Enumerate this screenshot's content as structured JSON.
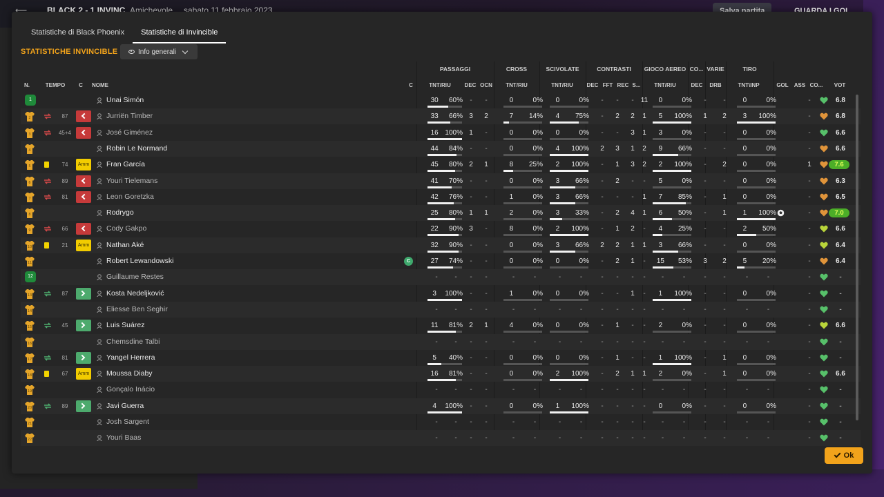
{
  "topbar": {
    "match": "BLACK  2 - 1  INVINC",
    "type": "Amichevole",
    "date": "sabato 11 febbraio 2023",
    "save_label": "Salva partita",
    "goals_label": "GUARDA I GOL"
  },
  "tabs": [
    "Statistiche di Black Phoenix",
    "Statistiche di Invincible"
  ],
  "active_tab": 1,
  "section_title": "STATISTICHE INVINCIBLE",
  "view_dropdown": "Info generali",
  "groups": {
    "passaggi": "PASSAGGI",
    "cross": "CROSS",
    "scivolate": "SCIVOLATE",
    "contrasti": "CONTRASTI",
    "gioco_aereo": "GIOCO AEREO",
    "co": "CO...",
    "varie": "VARIE",
    "tiro": "TIRO"
  },
  "headers": {
    "n": "N.",
    "tempo": "TEMPO",
    "c": "C",
    "nome": "NOME",
    "c2": "C",
    "pass_tnt": "TNT/RIU",
    "pass_dec": "DEC",
    "pass_ocn": "OCN",
    "cross_tnt": "TNT/RIU",
    "scivo_tnt": "TNT/RIU",
    "contr_dec": "DEC",
    "contr_fft": "FFT",
    "contr_rec": "REC",
    "contr_s": "S...",
    "aereo_tnt": "TNT/RIU",
    "co_dec": "DEC",
    "varie_drb": "DRB",
    "tiro_tnt": "TNT\\INP",
    "gol": "GOL",
    "ass": "ASS",
    "co": "CO...",
    "vot": "VOT"
  },
  "players": [
    {
      "n": "1",
      "gk": true,
      "tempo": "",
      "icon": "",
      "action": "",
      "name": "Unai Simón",
      "sub": false,
      "cap": false,
      "pass": [
        "30",
        "60%"
      ],
      "pbar": 0.6,
      "pdec": "-",
      "pocn": "-",
      "cross": [
        "0",
        "0%"
      ],
      "cbar": 0,
      "scivo": [
        "0",
        "0%"
      ],
      "sbar": 0,
      "cdec": "-",
      "cfft": "-",
      "crec": "-",
      "cs": "11",
      "aereo": [
        "0",
        "0%"
      ],
      "abar": 0,
      "codec": "-",
      "drb": "-",
      "tiro": [
        "0",
        "0%"
      ],
      "tbar": 0,
      "gol": "",
      "ass": "-",
      "heart": "#57c06a",
      "vot": "6.8",
      "vbadge": false
    },
    {
      "n": "2",
      "gk": false,
      "tempo": "87",
      "icon": "swap-red",
      "action": "out",
      "name": "Jurriën Timber",
      "sub": true,
      "cap": false,
      "pass": [
        "33",
        "66%"
      ],
      "pbar": 0.66,
      "pdec": "3",
      "pocn": "2",
      "cross": [
        "7",
        "14%"
      ],
      "cbar": 0.14,
      "scivo": [
        "4",
        "75%"
      ],
      "sbar": 0.75,
      "cdec": "-",
      "cfft": "2",
      "crec": "2",
      "cs": "1",
      "aereo": [
        "5",
        "100%"
      ],
      "abar": 1,
      "codec": "1",
      "drb": "2",
      "tiro": [
        "3",
        "100%"
      ],
      "tbar": 1,
      "gol": "",
      "ass": "-",
      "heart": "#e0943a",
      "vot": "6.8",
      "vbadge": false
    },
    {
      "n": "3",
      "gk": false,
      "tempo": "45+4",
      "icon": "swap-red",
      "action": "out",
      "name": "José Giménez",
      "sub": true,
      "cap": false,
      "pass": [
        "16",
        "100%"
      ],
      "pbar": 1,
      "pdec": "1",
      "pocn": "-",
      "cross": [
        "0",
        "0%"
      ],
      "cbar": 0,
      "scivo": [
        "0",
        "0%"
      ],
      "sbar": 0,
      "cdec": "-",
      "cfft": "-",
      "crec": "3",
      "cs": "1",
      "aereo": [
        "3",
        "0%"
      ],
      "abar": 0,
      "codec": "-",
      "drb": "-",
      "tiro": [
        "0",
        "0%"
      ],
      "tbar": 0,
      "gol": "",
      "ass": "-",
      "heart": "#57c06a",
      "vot": "6.6",
      "vbadge": false
    },
    {
      "n": "4",
      "gk": false,
      "tempo": "",
      "icon": "",
      "action": "",
      "name": "Robin Le Normand",
      "sub": false,
      "cap": false,
      "pass": [
        "44",
        "84%"
      ],
      "pbar": 0.84,
      "pdec": "-",
      "pocn": "-",
      "cross": [
        "0",
        "0%"
      ],
      "cbar": 0,
      "scivo": [
        "4",
        "100%"
      ],
      "sbar": 1,
      "cdec": "2",
      "cfft": "3",
      "crec": "1",
      "cs": "2",
      "aereo": [
        "9",
        "66%"
      ],
      "abar": 0.66,
      "codec": "-",
      "drb": "-",
      "tiro": [
        "0",
        "0%"
      ],
      "tbar": 0,
      "gol": "",
      "ass": "-",
      "heart": "#e0943a",
      "vot": "6.6",
      "vbadge": false
    },
    {
      "n": "5",
      "gk": false,
      "tempo": "74",
      "icon": "yellow",
      "action": "amm",
      "name": "Fran García",
      "sub": false,
      "cap": false,
      "pass": [
        "45",
        "80%"
      ],
      "pbar": 0.8,
      "pdec": "2",
      "pocn": "1",
      "cross": [
        "8",
        "25%"
      ],
      "cbar": 0.25,
      "scivo": [
        "2",
        "100%"
      ],
      "sbar": 1,
      "cdec": "-",
      "cfft": "1",
      "crec": "3",
      "cs": "2",
      "aereo": [
        "2",
        "100%"
      ],
      "abar": 1,
      "codec": "-",
      "drb": "2",
      "tiro": [
        "0",
        "0%"
      ],
      "tbar": 0,
      "gol": "",
      "ass": "1",
      "heart": "#e0943a",
      "vot": "7.6",
      "vbadge": true
    },
    {
      "n": "6",
      "gk": false,
      "tempo": "89",
      "icon": "swap-red",
      "action": "out",
      "name": "Youri Tielemans",
      "sub": true,
      "cap": false,
      "pass": [
        "41",
        "70%"
      ],
      "pbar": 0.7,
      "pdec": "-",
      "pocn": "-",
      "cross": [
        "0",
        "0%"
      ],
      "cbar": 0,
      "scivo": [
        "3",
        "66%"
      ],
      "sbar": 0.66,
      "cdec": "-",
      "cfft": "2",
      "crec": "-",
      "cs": "-",
      "aereo": [
        "5",
        "0%"
      ],
      "abar": 0,
      "codec": "-",
      "drb": "-",
      "tiro": [
        "0",
        "0%"
      ],
      "tbar": 0,
      "gol": "",
      "ass": "-",
      "heart": "#e0943a",
      "vot": "6.3",
      "vbadge": false
    },
    {
      "n": "7",
      "gk": false,
      "tempo": "81",
      "icon": "swap-red",
      "action": "out",
      "name": "Leon Goretzka",
      "sub": true,
      "cap": false,
      "pass": [
        "42",
        "76%"
      ],
      "pbar": 0.76,
      "pdec": "-",
      "pocn": "-",
      "cross": [
        "1",
        "0%"
      ],
      "cbar": 0,
      "scivo": [
        "3",
        "66%"
      ],
      "sbar": 0.66,
      "cdec": "-",
      "cfft": "-",
      "crec": "-",
      "cs": "1",
      "aereo": [
        "7",
        "85%"
      ],
      "abar": 0.85,
      "codec": "-",
      "drb": "1",
      "tiro": [
        "0",
        "0%"
      ],
      "tbar": 0,
      "gol": "",
      "ass": "-",
      "heart": "#e0943a",
      "vot": "6.5",
      "vbadge": false
    },
    {
      "n": "8",
      "gk": false,
      "tempo": "",
      "icon": "",
      "action": "",
      "name": "Rodrygo",
      "sub": false,
      "cap": false,
      "pass": [
        "25",
        "80%"
      ],
      "pbar": 0.8,
      "pdec": "1",
      "pocn": "1",
      "cross": [
        "2",
        "0%"
      ],
      "cbar": 0,
      "scivo": [
        "3",
        "33%"
      ],
      "sbar": 0.33,
      "cdec": "-",
      "cfft": "2",
      "crec": "4",
      "cs": "1",
      "aereo": [
        "6",
        "50%"
      ],
      "abar": 0.5,
      "codec": "-",
      "drb": "1",
      "tiro": [
        "1",
        "100%"
      ],
      "tbar": 1,
      "gol": "ball",
      "ass": "-",
      "heart": "#e0943a",
      "vot": "7.0",
      "vbadge": true
    },
    {
      "n": "9",
      "gk": false,
      "tempo": "66",
      "icon": "swap-red",
      "action": "out",
      "name": "Cody Gakpo",
      "sub": true,
      "cap": false,
      "pass": [
        "22",
        "90%"
      ],
      "pbar": 0.9,
      "pdec": "3",
      "pocn": "-",
      "cross": [
        "8",
        "0%"
      ],
      "cbar": 0,
      "scivo": [
        "2",
        "100%"
      ],
      "sbar": 1,
      "cdec": "-",
      "cfft": "1",
      "crec": "2",
      "cs": "-",
      "aereo": [
        "4",
        "25%"
      ],
      "abar": 0.25,
      "codec": "-",
      "drb": "-",
      "tiro": [
        "2",
        "50%"
      ],
      "tbar": 0.5,
      "gol": "",
      "ass": "-",
      "heart": "#b8d43a",
      "vot": "6.6",
      "vbadge": false
    },
    {
      "n": "10",
      "gk": false,
      "tempo": "21",
      "icon": "yellow",
      "action": "amm",
      "name": "Nathan Aké",
      "sub": false,
      "cap": false,
      "pass": [
        "32",
        "90%"
      ],
      "pbar": 0.9,
      "pdec": "-",
      "pocn": "-",
      "cross": [
        "0",
        "0%"
      ],
      "cbar": 0,
      "scivo": [
        "3",
        "66%"
      ],
      "sbar": 0.66,
      "cdec": "2",
      "cfft": "2",
      "crec": "1",
      "cs": "1",
      "aereo": [
        "3",
        "66%"
      ],
      "abar": 0.66,
      "codec": "-",
      "drb": "-",
      "tiro": [
        "0",
        "0%"
      ],
      "tbar": 0,
      "gol": "",
      "ass": "-",
      "heart": "#b8d43a",
      "vot": "6.4",
      "vbadge": false
    },
    {
      "n": "11",
      "gk": false,
      "tempo": "",
      "icon": "",
      "action": "",
      "name": "Robert Lewandowski",
      "sub": false,
      "cap": true,
      "pass": [
        "27",
        "74%"
      ],
      "pbar": 0.74,
      "pdec": "-",
      "pocn": "-",
      "cross": [
        "0",
        "0%"
      ],
      "cbar": 0,
      "scivo": [
        "0",
        "0%"
      ],
      "sbar": 0,
      "cdec": "-",
      "cfft": "2",
      "crec": "1",
      "cs": "-",
      "aereo": [
        "15",
        "53%"
      ],
      "abar": 0.53,
      "codec": "3",
      "drb": "2",
      "tiro": [
        "5",
        "20%"
      ],
      "tbar": 0.2,
      "gol": "",
      "ass": "-",
      "heart": "#e0943a",
      "vot": "6.4",
      "vbadge": false
    },
    {
      "n": "12",
      "gk": true,
      "tempo": "",
      "icon": "",
      "action": "",
      "name": "Guillaume Restes",
      "sub": true,
      "cap": false,
      "pass": [
        "-",
        "-"
      ],
      "pbar": -1,
      "pdec": "-",
      "pocn": "-",
      "cross": [
        "-",
        "-"
      ],
      "cbar": -1,
      "scivo": [
        "-",
        "-"
      ],
      "sbar": -1,
      "cdec": "-",
      "cfft": "-",
      "crec": "-",
      "cs": "-",
      "aereo": [
        "-",
        "-"
      ],
      "abar": -1,
      "codec": "-",
      "drb": "-",
      "tiro": [
        "-",
        "-"
      ],
      "tbar": -1,
      "gol": "",
      "ass": "-",
      "heart": "#57c06a",
      "vot": "-",
      "vbadge": false
    },
    {
      "n": "13",
      "gk": false,
      "tempo": "87",
      "icon": "swap-green",
      "action": "in",
      "name": "Kosta Nedeljković",
      "sub": false,
      "cap": false,
      "pass": [
        "3",
        "100%"
      ],
      "pbar": 1,
      "pdec": "-",
      "pocn": "-",
      "cross": [
        "1",
        "0%"
      ],
      "cbar": 0,
      "scivo": [
        "0",
        "0%"
      ],
      "sbar": 0,
      "cdec": "-",
      "cfft": "-",
      "crec": "1",
      "cs": "-",
      "aereo": [
        "1",
        "100%"
      ],
      "abar": 1,
      "codec": "-",
      "drb": "-",
      "tiro": [
        "0",
        "0%"
      ],
      "tbar": 0,
      "gol": "",
      "ass": "-",
      "heart": "#57c06a",
      "vot": "-",
      "vbadge": false
    },
    {
      "n": "14",
      "gk": false,
      "tempo": "",
      "icon": "",
      "action": "",
      "name": "Eliesse Ben Seghir",
      "sub": true,
      "cap": false,
      "pass": [
        "-",
        "-"
      ],
      "pbar": -1,
      "pdec": "-",
      "pocn": "-",
      "cross": [
        "-",
        "-"
      ],
      "cbar": -1,
      "scivo": [
        "-",
        "-"
      ],
      "sbar": -1,
      "cdec": "-",
      "cfft": "-",
      "crec": "-",
      "cs": "-",
      "aereo": [
        "-",
        "-"
      ],
      "abar": -1,
      "codec": "-",
      "drb": "-",
      "tiro": [
        "-",
        "-"
      ],
      "tbar": -1,
      "gol": "",
      "ass": "-",
      "heart": "#57c06a",
      "vot": "-",
      "vbadge": false
    },
    {
      "n": "15",
      "gk": false,
      "tempo": "45",
      "icon": "swap-green",
      "action": "in",
      "name": "Luis Suárez",
      "sub": false,
      "cap": false,
      "pass": [
        "11",
        "81%"
      ],
      "pbar": 0.81,
      "pdec": "2",
      "pocn": "1",
      "cross": [
        "4",
        "0%"
      ],
      "cbar": 0,
      "scivo": [
        "0",
        "0%"
      ],
      "sbar": 0,
      "cdec": "-",
      "cfft": "1",
      "crec": "-",
      "cs": "-",
      "aereo": [
        "2",
        "0%"
      ],
      "abar": 0,
      "codec": "-",
      "drb": "-",
      "tiro": [
        "0",
        "0%"
      ],
      "tbar": 0,
      "gol": "",
      "ass": "-",
      "heart": "#b8d43a",
      "vot": "6.6",
      "vbadge": false
    },
    {
      "n": "16",
      "gk": false,
      "tempo": "",
      "icon": "",
      "action": "",
      "name": "Chemsdine Talbi",
      "sub": true,
      "cap": false,
      "pass": [
        "-",
        "-"
      ],
      "pbar": -1,
      "pdec": "-",
      "pocn": "-",
      "cross": [
        "-",
        "-"
      ],
      "cbar": -1,
      "scivo": [
        "-",
        "-"
      ],
      "sbar": -1,
      "cdec": "-",
      "cfft": "-",
      "crec": "-",
      "cs": "-",
      "aereo": [
        "-",
        "-"
      ],
      "abar": -1,
      "codec": "-",
      "drb": "-",
      "tiro": [
        "-",
        "-"
      ],
      "tbar": -1,
      "gol": "",
      "ass": "-",
      "heart": "#57c06a",
      "vot": "-",
      "vbadge": false
    },
    {
      "n": "17",
      "gk": false,
      "tempo": "81",
      "icon": "swap-green",
      "action": "in",
      "name": "Yangel Herrera",
      "sub": false,
      "cap": false,
      "pass": [
        "5",
        "40%"
      ],
      "pbar": 0.4,
      "pdec": "-",
      "pocn": "-",
      "cross": [
        "0",
        "0%"
      ],
      "cbar": 0,
      "scivo": [
        "0",
        "0%"
      ],
      "sbar": 0,
      "cdec": "-",
      "cfft": "1",
      "crec": "-",
      "cs": "-",
      "aereo": [
        "1",
        "100%"
      ],
      "abar": 1,
      "codec": "-",
      "drb": "1",
      "tiro": [
        "0",
        "0%"
      ],
      "tbar": 0,
      "gol": "",
      "ass": "-",
      "heart": "#57c06a",
      "vot": "-",
      "vbadge": false
    },
    {
      "n": "18",
      "gk": false,
      "tempo": "67",
      "icon": "yellow",
      "action": "amm",
      "name": "Moussa Diaby",
      "sub": false,
      "cap": false,
      "pass": [
        "16",
        "81%"
      ],
      "pbar": 0.81,
      "pdec": "-",
      "pocn": "-",
      "cross": [
        "0",
        "0%"
      ],
      "cbar": 0,
      "scivo": [
        "2",
        "100%"
      ],
      "sbar": 1,
      "cdec": "-",
      "cfft": "2",
      "crec": "1",
      "cs": "1",
      "aereo": [
        "2",
        "0%"
      ],
      "abar": 0,
      "codec": "-",
      "drb": "1",
      "tiro": [
        "0",
        "0%"
      ],
      "tbar": 0,
      "gol": "",
      "ass": "-",
      "heart": "#57c06a",
      "vot": "6.6",
      "vbadge": false
    },
    {
      "n": "19",
      "gk": false,
      "tempo": "",
      "icon": "",
      "action": "",
      "name": "Gonçalo Inácio",
      "sub": true,
      "cap": false,
      "pass": [
        "-",
        "-"
      ],
      "pbar": -1,
      "pdec": "-",
      "pocn": "-",
      "cross": [
        "-",
        "-"
      ],
      "cbar": -1,
      "scivo": [
        "-",
        "-"
      ],
      "sbar": -1,
      "cdec": "-",
      "cfft": "-",
      "crec": "-",
      "cs": "-",
      "aereo": [
        "-",
        "-"
      ],
      "abar": -1,
      "codec": "-",
      "drb": "-",
      "tiro": [
        "-",
        "-"
      ],
      "tbar": -1,
      "gol": "",
      "ass": "-",
      "heart": "#57c06a",
      "vot": "-",
      "vbadge": false
    },
    {
      "n": "20",
      "gk": false,
      "tempo": "89",
      "icon": "swap-green",
      "action": "in",
      "name": "Javi Guerra",
      "sub": false,
      "cap": false,
      "pass": [
        "4",
        "100%"
      ],
      "pbar": 1,
      "pdec": "-",
      "pocn": "-",
      "cross": [
        "0",
        "0%"
      ],
      "cbar": 0,
      "scivo": [
        "1",
        "100%"
      ],
      "sbar": 1,
      "cdec": "-",
      "cfft": "-",
      "crec": "-",
      "cs": "-",
      "aereo": [
        "0",
        "0%"
      ],
      "abar": 0,
      "codec": "-",
      "drb": "-",
      "tiro": [
        "0",
        "0%"
      ],
      "tbar": 0,
      "gol": "",
      "ass": "-",
      "heart": "#57c06a",
      "vot": "-",
      "vbadge": false
    },
    {
      "n": "21",
      "gk": false,
      "tempo": "",
      "icon": "",
      "action": "",
      "name": "Josh Sargent",
      "sub": true,
      "cap": false,
      "pass": [
        "-",
        "-"
      ],
      "pbar": -1,
      "pdec": "-",
      "pocn": "-",
      "cross": [
        "-",
        "-"
      ],
      "cbar": -1,
      "scivo": [
        "-",
        "-"
      ],
      "sbar": -1,
      "cdec": "-",
      "cfft": "-",
      "crec": "-",
      "cs": "-",
      "aereo": [
        "-",
        "-"
      ],
      "abar": -1,
      "codec": "-",
      "drb": "-",
      "tiro": [
        "-",
        "-"
      ],
      "tbar": -1,
      "gol": "",
      "ass": "-",
      "heart": "#57c06a",
      "vot": "-",
      "vbadge": false
    },
    {
      "n": "22",
      "gk": false,
      "tempo": "",
      "icon": "",
      "action": "",
      "name": "Youri Baas",
      "sub": true,
      "cap": false,
      "pass": [
        "-",
        "-"
      ],
      "pbar": -1,
      "pdec": "-",
      "pocn": "-",
      "cross": [
        "-",
        "-"
      ],
      "cbar": -1,
      "scivo": [
        "-",
        "-"
      ],
      "sbar": -1,
      "cdec": "-",
      "cfft": "-",
      "crec": "-",
      "cs": "-",
      "aereo": [
        "-",
        "-"
      ],
      "abar": -1,
      "codec": "-",
      "drb": "-",
      "tiro": [
        "-",
        "-"
      ],
      "tbar": -1,
      "gol": "",
      "ass": "-",
      "heart": "#57c06a",
      "vot": "-",
      "vbadge": false
    }
  ],
  "captain_badge": "C",
  "amm_label": "Amm",
  "ok_label": "Ok",
  "colors": {
    "accent": "#f2a31b",
    "shirt": "#e5a52a",
    "gk": "#1f8a3a",
    "out": "#c63a3a",
    "in": "#4daa6d",
    "card": "#f2d300",
    "vote_badge": "#4cae28"
  }
}
